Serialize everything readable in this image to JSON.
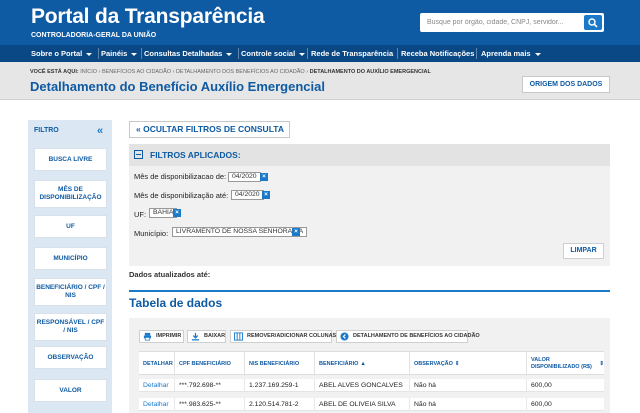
{
  "header": {
    "title": "Portal da Transparência",
    "subtitle": "CONTROLADORIA-GERAL DA UNIÃO",
    "search_placeholder": "Busque por órgão, cidade, CNPJ, servidor..."
  },
  "nav": {
    "items": [
      {
        "label": "Sobre o Portal",
        "dropdown": true
      },
      {
        "label": "Painéis",
        "dropdown": true
      },
      {
        "label": "Consultas Detalhadas",
        "dropdown": true
      },
      {
        "label": "Controle social",
        "dropdown": true
      },
      {
        "label": "Rede de Transparência",
        "dropdown": false
      },
      {
        "label": "Receba Notificações",
        "dropdown": false
      },
      {
        "label": "Aprenda mais",
        "dropdown": true
      }
    ]
  },
  "breadcrumb": {
    "prefix": "VOCÊ ESTÁ AQUI:",
    "items": [
      "INÍCIO",
      "BENEFÍCIOS AO CIDADÃO",
      "DETALHAMENTO DOS BENEFÍCIOS AO CIDADÃO",
      "DETALHAMENTO DO AUXÍLIO EMERGENCIAL"
    ],
    "separator": "›"
  },
  "page": {
    "title": "Detalhamento do Benefício Auxílio Emergencial",
    "origin_button": "ORIGEM DOS DADOS"
  },
  "sidebar": {
    "title": "FILTRO",
    "collapse_glyph": "«",
    "items": [
      "BUSCA LIVRE",
      "MÊS DE DISPONIBILIZAÇÃO",
      "UF",
      "MUNICÍPIO",
      "BENEFICIÁRIO / CPF / NIS",
      "RESPONSÁVEL / CPF / NIS",
      "OBSERVAÇÃO",
      "VALOR"
    ]
  },
  "filters": {
    "hide_button": "« OCULTAR FILTROS DE CONSULTA",
    "title": "FILTROS APLICADOS:",
    "rows": [
      {
        "label": "Mês de disponibilizacao de:",
        "value": "04/2020"
      },
      {
        "label": "Mês de disponibilização até:",
        "value": "04/2020"
      },
      {
        "label": "UF:",
        "value": "BAHIA"
      },
      {
        "label": "Município:",
        "value": "LIVRAMENTO DE NOSSA SENHORA/BA"
      }
    ],
    "remove_glyph": "×",
    "clear_button": "LIMPAR"
  },
  "updated_label": "Dados atualizados até:",
  "table": {
    "title": "Tabela de dados",
    "toolbar": [
      {
        "label": "IMPRIMIR",
        "icon": "print-icon"
      },
      {
        "label": "BAIXAR",
        "icon": "download-icon"
      },
      {
        "label": "REMOVER/ADICIONAR COLUNAS",
        "icon": "columns-icon"
      },
      {
        "label": "DETALHAMENTO DE BENEFÍCIOS AO CIDADÃO",
        "icon": "back-circle-icon"
      }
    ],
    "columns": [
      {
        "label": "DETALHAR",
        "sort": ""
      },
      {
        "label": "CPF BENEFICIÁRIO",
        "sort": ""
      },
      {
        "label": "NIS BENEFICIÁRIO",
        "sort": ""
      },
      {
        "label": "BENEFICIÁRIO",
        "sort": "▲"
      },
      {
        "label": "OBSERVAÇÃO",
        "sort": "⇕"
      },
      {
        "label": "VALOR DISPONIBILIZADO (R$)",
        "sort": "⇕"
      }
    ],
    "rows": [
      [
        "Detalhar",
        "***.792.698-**",
        "1.237.169.259-1",
        "ABEL ALVES GONCALVES",
        "Não há",
        "600,00"
      ],
      [
        "Detalhar",
        "***.983.625-**",
        "2.120.514.781-2",
        "ABEL DE OLIVEIA SILVA",
        "Não há",
        "600,00"
      ]
    ]
  },
  "colors": {
    "header_blue": "#0e5aa3",
    "nav_blue": "#0a4785",
    "accent": "#1a79c9",
    "sidebar_bg": "#dbe8f3"
  }
}
